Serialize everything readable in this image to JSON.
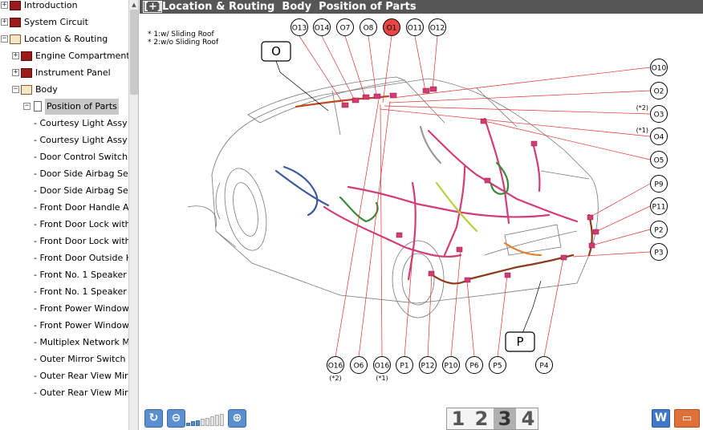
{
  "tree": {
    "items": [
      {
        "label": "Introduction",
        "level": 0,
        "expander": "+",
        "icon": "book"
      },
      {
        "label": "System Circuit",
        "level": 0,
        "expander": "+",
        "icon": "book"
      },
      {
        "label": "Location & Routing",
        "level": 0,
        "expander": "-",
        "icon": "open-book"
      },
      {
        "label": "Engine Compartment",
        "level": 1,
        "expander": "+",
        "icon": "book"
      },
      {
        "label": "Instrument Panel",
        "level": 1,
        "expander": "+",
        "icon": "book"
      },
      {
        "label": "Body",
        "level": 1,
        "expander": "-",
        "icon": "open-book"
      },
      {
        "label": "Position of Parts",
        "level": 2,
        "expander": "-",
        "icon": "page",
        "selected": true
      },
      {
        "label": "- Courtesy Light Assy",
        "level": 3
      },
      {
        "label": "- Courtesy Light Assy",
        "level": 3
      },
      {
        "label": "- Door Control Switch",
        "level": 3
      },
      {
        "label": "- Door Side Airbag Sensor",
        "level": 3
      },
      {
        "label": "- Door Side Airbag Sensor",
        "level": 3
      },
      {
        "label": "- Front Door Handle Assy",
        "level": 3
      },
      {
        "label": "- Front Door Lock with Motor",
        "level": 3
      },
      {
        "label": "- Front Door Lock with Motor",
        "level": 3
      },
      {
        "label": "- Front Door Outside Handle",
        "level": 3
      },
      {
        "label": "- Front No. 1 Speaker",
        "level": 3
      },
      {
        "label": "- Front No. 1 Speaker",
        "level": 3
      },
      {
        "label": "- Front Power Window Motor",
        "level": 3
      },
      {
        "label": "- Front Power Window Motor",
        "level": 3
      },
      {
        "label": "- Multiplex Network Master Switch",
        "level": 3
      },
      {
        "label": "- Outer Mirror Switch",
        "level": 3
      },
      {
        "label": "- Outer Rear View Mirror",
        "level": 3
      },
      {
        "label": "- Outer Rear View Mirror",
        "level": 3
      }
    ]
  },
  "header": {
    "button": "[+]",
    "title": "Location & Routing  Body  Position of Parts"
  },
  "notes": [
    "* 1:w/ Sliding Roof",
    "* 2:w/o Sliding Roof"
  ],
  "diagram": {
    "group_labels": [
      "O",
      "P"
    ],
    "top_connectors": [
      "O13",
      "O14",
      "O7",
      "O8",
      "O1",
      "O11",
      "O12"
    ],
    "highlighted": "O1",
    "right_connectors": [
      {
        "id": "O10",
        "note": ""
      },
      {
        "id": "O2",
        "note": ""
      },
      {
        "id": "O3",
        "note": "(*2)"
      },
      {
        "id": "O4",
        "note": "(*1)"
      },
      {
        "id": "O5",
        "note": ""
      },
      {
        "id": "P9",
        "note": ""
      },
      {
        "id": "P11",
        "note": ""
      },
      {
        "id": "P2",
        "note": ""
      },
      {
        "id": "P3",
        "note": ""
      }
    ],
    "bottom_connectors": [
      {
        "id": "O16",
        "note": "(*2)"
      },
      {
        "id": "O6",
        "note": ""
      },
      {
        "id": "O16",
        "note": "(*1)"
      },
      {
        "id": "P1",
        "note": ""
      },
      {
        "id": "P12",
        "note": ""
      },
      {
        "id": "P10",
        "note": ""
      },
      {
        "id": "P6",
        "note": ""
      },
      {
        "id": "P5",
        "note": ""
      },
      {
        "id": "P4",
        "note": ""
      }
    ],
    "colors": {
      "wire": "#d23c78",
      "lead": "#e03030",
      "highlight": "#e84545",
      "harness_brown": "#8b3a1a"
    }
  },
  "toolbar": {
    "refresh_icon": "refresh-icon",
    "zoom_out_icon": "zoom-out-icon",
    "zoom_in_icon": "zoom-in-icon",
    "zoom_level": 0.4,
    "pages": [
      "1",
      "2",
      "3",
      "4"
    ],
    "active_page": "3",
    "w_button": "W",
    "comment_icon": "comment-icon"
  }
}
